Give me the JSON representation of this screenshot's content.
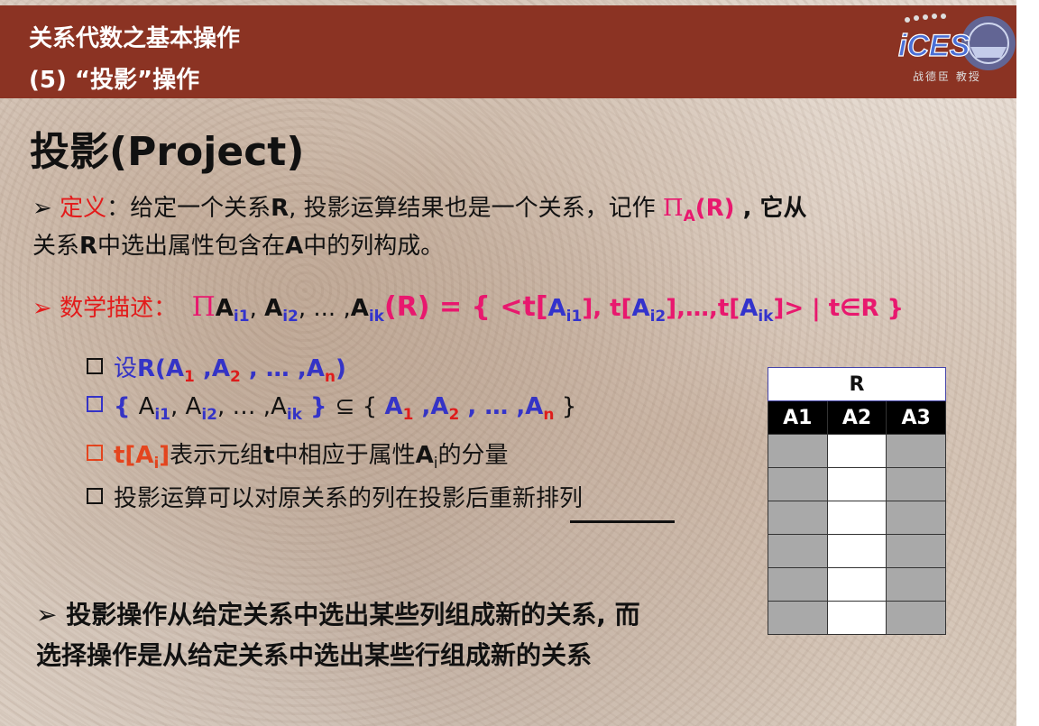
{
  "header": {
    "line1": "关系代数之基本操作",
    "line2": "(5) “投影”操作",
    "logo_caption": "战德臣 教授",
    "logo_text": "iCES"
  },
  "title": "投影(Project)",
  "definition": {
    "marker": "➢",
    "label": "定义",
    "text1": "：给定一个关系",
    "R1": "R",
    "text2": ", 投影运算结果也是一个关系，记作 ",
    "pi": "Π",
    "pi_sub": "A",
    "pi_arg": "(R)",
    "text3": " , 它从",
    "line2_a": "关系",
    "line2_R": "R",
    "line2_b": "中选出属性包含在",
    "line2_A": "A",
    "line2_c": "中的列构成。"
  },
  "math": {
    "marker": "➢",
    "label": "数学描述：",
    "pi": "Π",
    "a": "A",
    "s1": "i1",
    "s2": "i2",
    "sk": "ik",
    "sep": ", ",
    "dots": ", ... ,",
    "rhs_a": "(R) = { <t[",
    "rhs_b": "], t[",
    "rhs_c": "],…,t[",
    "rhs_d": "]>  |  t∈R }"
  },
  "bullets": {
    "b1_pre": "设",
    "b1_main": "R(A",
    "b1_s1": "1",
    "b1_m2": " ,A",
    "b1_s2": "2",
    "b1_m3": " , … ,A",
    "b1_sn": "n",
    "b1_end": ")",
    "b2_open": "{ ",
    "b2_a": "A",
    "b2_s1": "i1",
    "b2_s2": "i2",
    "b2_sk": "ik",
    "b2_sep": ", ",
    "b2_dots": ", … ,",
    "b2_close": " } ",
    "b2_subset": "⊆",
    "b2_set_open": " { ",
    "b2_r1": "A",
    "b2_r_s1": "1",
    "b2_r2": " ,A",
    "b2_r_s2": "2",
    "b2_r3": " , … ,A",
    "b2_r_sn": "n",
    "b2_set_close": " }",
    "b3_t": "t[A",
    "b3_s": "i",
    "b3_close": "]",
    "b3_text1": "表示元组",
    "b3_tb": "t",
    "b3_text2": "中相应于属性",
    "b3_A": "A",
    "b3_As": "i",
    "b3_text3": "的分量",
    "b4_text1": "投影运算可以对原关系的列在投影后",
    "b4_text2": "重新排列"
  },
  "summary": {
    "line1": "➢ 投影操作从给定关系中选出某些列组成新的关系, 而",
    "line2": "选择操作是从给定关系中选出某些行组成新的关系"
  },
  "table": {
    "name": "R",
    "columns": [
      "A1",
      "A2",
      "A3"
    ],
    "row_count": 6
  }
}
